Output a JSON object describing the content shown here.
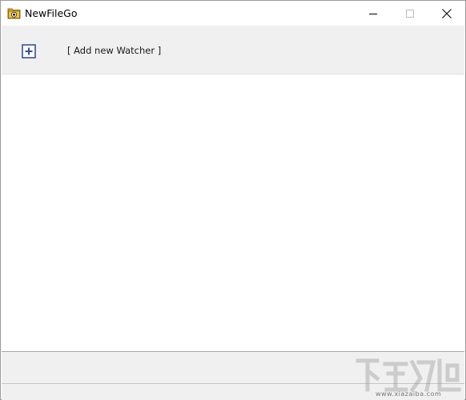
{
  "window": {
    "title": "NewFileGo",
    "controls": {
      "minimize_icon": "minimize-icon",
      "maximize_icon": "maximize-icon",
      "close_icon": "close-icon"
    }
  },
  "toolbar": {
    "add_watcher_label": "[ Add new Watcher ]",
    "add_icon": "plus-box-icon"
  },
  "watermark": {
    "text": "www.xiazaiba.com",
    "logo_icon": "xiazaiba-logo"
  },
  "colors": {
    "toolbar_bg": "#f0f0f0",
    "content_bg": "#ffffff",
    "add_icon_color": "#3c4f9a"
  }
}
